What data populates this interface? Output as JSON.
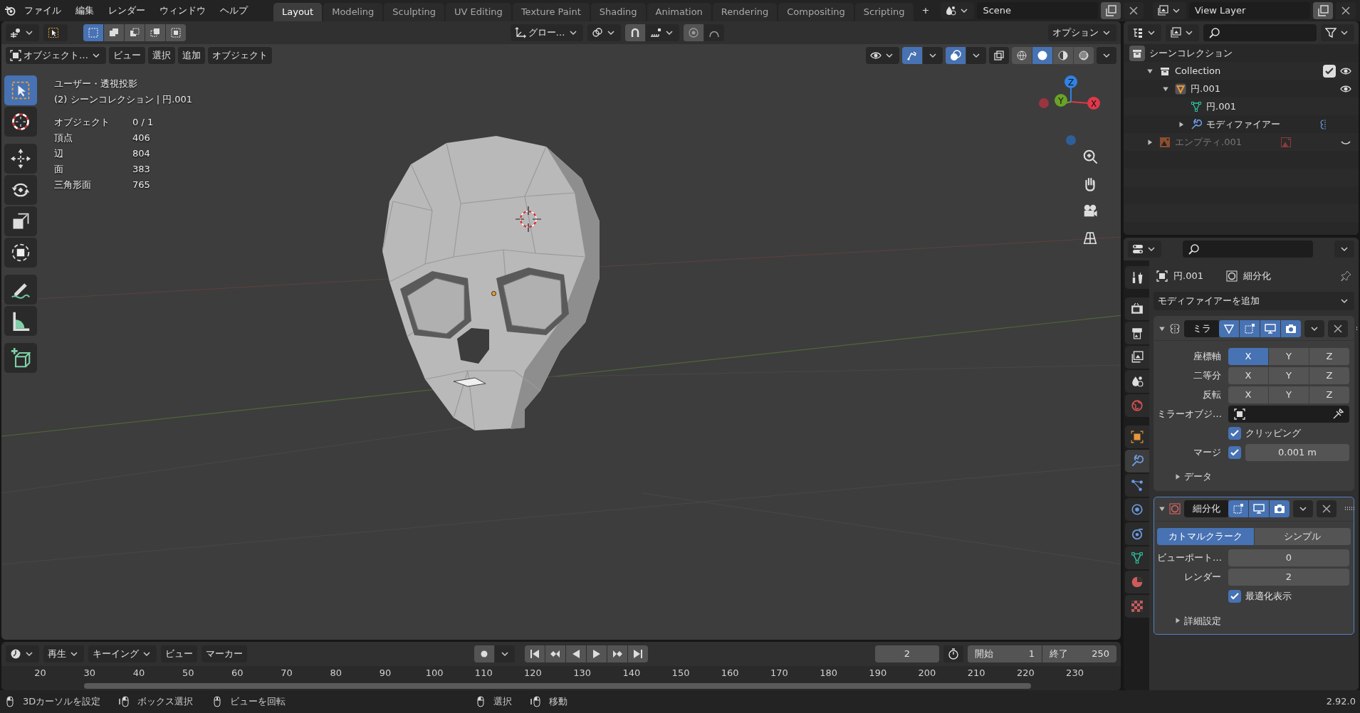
{
  "menu": [
    {
      "label": "ファイル"
    },
    {
      "label": "編集"
    },
    {
      "label": "レンダー"
    },
    {
      "label": "ウィンドウ"
    },
    {
      "label": "ヘルプ"
    }
  ],
  "workspaces": [
    {
      "label": "Layout",
      "selected": true
    },
    {
      "label": "Modeling",
      "selected": false
    },
    {
      "label": "Sculpting",
      "selected": false
    },
    {
      "label": "UV Editing",
      "selected": false
    },
    {
      "label": "Texture Paint",
      "selected": false
    },
    {
      "label": "Shading",
      "selected": false
    },
    {
      "label": "Animation",
      "selected": false
    },
    {
      "label": "Rendering",
      "selected": false
    },
    {
      "label": "Compositing",
      "selected": false
    },
    {
      "label": "Scripting",
      "selected": false
    }
  ],
  "add_workspace": "+",
  "scene": "Scene",
  "view_layer": "View Layer",
  "tool_header": {
    "select_modes": [
      {
        "kind": "set",
        "selected": true
      },
      {
        "kind": "extend",
        "selected": false
      },
      {
        "kind": "subtract",
        "selected": false
      },
      {
        "kind": "difference",
        "selected": false
      },
      {
        "kind": "intersect",
        "selected": false
      }
    ],
    "orientation": "グロー…",
    "options": "オプション"
  },
  "viewport_header": {
    "mode": "オブジェクト…",
    "menus": [
      "ビュー",
      "選択",
      "追加",
      "オブジェクト"
    ],
    "gizmos_on": true,
    "overlays_on": true,
    "xray_on": false,
    "shading": [
      {
        "kind": "wireframe",
        "selected": false
      },
      {
        "kind": "solid",
        "selected": true
      },
      {
        "kind": "material",
        "selected": false
      },
      {
        "kind": "rendered",
        "selected": false
      }
    ]
  },
  "viewport": {
    "view_name": "ユーザー・透視投影",
    "context": "(2) シーンコレクション | 円.001",
    "stats": [
      {
        "label": "オブジェクト",
        "value": "0 / 1"
      },
      {
        "label": "頂点",
        "value": "406"
      },
      {
        "label": "辺",
        "value": "804"
      },
      {
        "label": "面",
        "value": "383"
      },
      {
        "label": "三角形面",
        "value": "765"
      }
    ],
    "tools": [
      {
        "kind": "select",
        "selected": true
      },
      {
        "kind": "cursor",
        "selected": false
      },
      {
        "kind": "move",
        "selected": false
      },
      {
        "kind": "rotate",
        "selected": false
      },
      {
        "kind": "scale",
        "selected": false
      },
      {
        "kind": "transform",
        "selected": false
      },
      {
        "kind": "annotate",
        "selected": false
      },
      {
        "kind": "measure",
        "selected": false
      },
      {
        "kind": "add-cube",
        "selected": false
      }
    ],
    "gizmo_axes": [
      {
        "kind": "z",
        "label": "Z"
      },
      {
        "kind": "y",
        "label": "Y"
      },
      {
        "kind": "x",
        "label": "X"
      }
    ]
  },
  "outliner": {
    "root": "シーンコレクション",
    "items": [
      {
        "label": "Collection",
        "kind": "collection",
        "expanded": true,
        "checked": true,
        "hidden": false,
        "children": [
          {
            "label": "円.001",
            "kind": "object",
            "expanded": true,
            "hidden": false,
            "children": [
              {
                "label": "円.001",
                "kind": "mesh"
              },
              {
                "label": "モディファイアー",
                "kind": "modifiers",
                "expanded": false
              }
            ]
          }
        ]
      },
      {
        "label": "エンプティ.001",
        "kind": "empty",
        "expanded": false,
        "hidden": true
      }
    ]
  },
  "properties": {
    "tabs": [
      {
        "kind": "tool",
        "selected": false
      },
      {
        "kind": "render",
        "selected": false
      },
      {
        "kind": "output",
        "selected": false
      },
      {
        "kind": "view-layer",
        "selected": false
      },
      {
        "kind": "scene",
        "selected": false
      },
      {
        "kind": "world",
        "selected": false
      },
      {
        "kind": "object",
        "selected": false
      },
      {
        "kind": "modifiers",
        "selected": true
      },
      {
        "kind": "particles",
        "selected": false
      },
      {
        "kind": "physics",
        "selected": false
      },
      {
        "kind": "constraints",
        "selected": false
      },
      {
        "kind": "data",
        "selected": false
      },
      {
        "kind": "material",
        "selected": false
      },
      {
        "kind": "texture",
        "selected": false
      }
    ],
    "breadcrumb": [
      "円.001",
      "細分化"
    ],
    "add_modifier": "モディファイアーを追加",
    "modifiers": [
      {
        "kind": "mirror",
        "name": "ミラ",
        "expanded": true,
        "active": false,
        "toggles": [
          {
            "kind": "cage",
            "on": true
          },
          {
            "kind": "editmode",
            "on": true
          },
          {
            "kind": "viewport",
            "on": true
          },
          {
            "kind": "render",
            "on": true
          }
        ],
        "rows": [
          {
            "kind": "axis-toggles",
            "label": "座標軸",
            "options": [
              {
                "label": "X",
                "selected": true
              },
              {
                "label": "Y",
                "selected": false
              },
              {
                "label": "Z",
                "selected": false
              }
            ]
          },
          {
            "kind": "axis-toggles",
            "label": "二等分",
            "options": [
              {
                "label": "X",
                "selected": false
              },
              {
                "label": "Y",
                "selected": false
              },
              {
                "label": "Z",
                "selected": false
              }
            ]
          },
          {
            "kind": "axis-toggles",
            "label": "反転",
            "options": [
              {
                "label": "X",
                "selected": false
              },
              {
                "label": "Y",
                "selected": false
              },
              {
                "label": "Z",
                "selected": false
              }
            ]
          },
          {
            "kind": "object-field",
            "label": "ミラーオブジ…"
          },
          {
            "kind": "checkbox",
            "label": "クリッピング",
            "checked": true
          },
          {
            "kind": "checkbox-number",
            "label": "マージ",
            "checked": true,
            "value": "0.001 m"
          },
          {
            "kind": "subpanel",
            "label": "データ",
            "expanded": false
          }
        ]
      },
      {
        "kind": "subdivision",
        "name": "細分化",
        "expanded": true,
        "active": true,
        "toggles": [
          {
            "kind": "editmode",
            "on": true
          },
          {
            "kind": "viewport",
            "on": true
          },
          {
            "kind": "render",
            "on": true
          }
        ],
        "rows": [
          {
            "kind": "segmented",
            "options": [
              {
                "label": "カトマルクラーク",
                "selected": true
              },
              {
                "label": "シンプル",
                "selected": false
              }
            ]
          },
          {
            "kind": "number",
            "label": "ビューポート…",
            "value": "0"
          },
          {
            "kind": "number",
            "label": "レンダー",
            "value": "2"
          },
          {
            "kind": "checkbox",
            "label": "最適化表示",
            "checked": true
          },
          {
            "kind": "subpanel",
            "label": "詳細設定",
            "expanded": false
          }
        ]
      }
    ]
  },
  "timeline": {
    "menus": [
      {
        "label": "再生",
        "dropdown": true
      },
      {
        "label": "キーイング",
        "dropdown": true
      },
      {
        "label": "ビュー",
        "dropdown": false
      },
      {
        "label": "マーカー",
        "dropdown": false
      }
    ],
    "current_frame": "2",
    "start_label": "開始",
    "start": "1",
    "end_label": "終了",
    "end": "250",
    "ruler": [
      "20",
      "30",
      "40",
      "50",
      "60",
      "70",
      "80",
      "90",
      "100",
      "110",
      "120",
      "130",
      "140",
      "150",
      "160",
      "170",
      "180",
      "190",
      "200",
      "210",
      "220",
      "230"
    ]
  },
  "status_bar": {
    "items": [
      {
        "kind": "left",
        "label": "3Dカーソルを設定"
      },
      {
        "kind": "drag",
        "label": "ボックス選択"
      },
      {
        "kind": "middle",
        "label": "ビューを回転"
      },
      {
        "kind": "left",
        "label": "選択"
      },
      {
        "kind": "drag",
        "label": "移動"
      }
    ],
    "version": "2.92.0"
  }
}
